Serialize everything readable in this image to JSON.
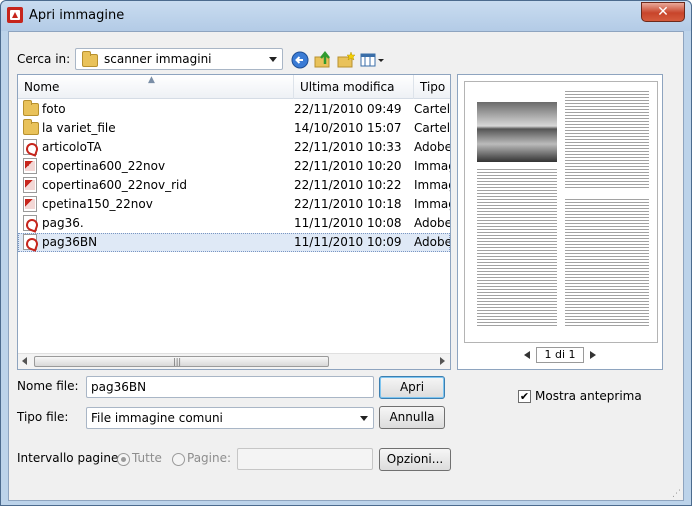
{
  "window": {
    "title": "Apri immagine",
    "close_glyph": "✕",
    "app_icon": "scanner-app-icon"
  },
  "location": {
    "label": "Cerca in:",
    "folder": "scanner immagini"
  },
  "toolbar": {
    "icons": [
      "back-icon",
      "up-folder-icon",
      "new-folder-icon",
      "view-menu-icon"
    ]
  },
  "columns": [
    "Nome",
    "Ultima modifica",
    "Tipo"
  ],
  "files": [
    {
      "name": "foto",
      "date": "22/11/2010 09:49",
      "type": "Cartella",
      "icon": "folder-icon"
    },
    {
      "name": "la variet_file",
      "date": "14/10/2010 15:07",
      "type": "Cartella",
      "icon": "folder-icon"
    },
    {
      "name": "articoloTA",
      "date": "22/11/2010 10:33",
      "type": "Adobe",
      "icon": "pdf-icon"
    },
    {
      "name": "copertina600_22nov",
      "date": "22/11/2010 10:20",
      "type": "Immagine",
      "icon": "image-icon"
    },
    {
      "name": "copertina600_22nov_rid",
      "date": "22/11/2010 10:22",
      "type": "Immagine",
      "icon": "image-icon"
    },
    {
      "name": "cpetina150_22nov",
      "date": "22/11/2010 10:18",
      "type": "Immagine",
      "icon": "image-icon"
    },
    {
      "name": "pag36.",
      "date": "11/11/2010 10:08",
      "type": "Adobe",
      "icon": "pdf-icon"
    },
    {
      "name": "pag36BN",
      "date": "11/11/2010 10:09",
      "type": "Adobe",
      "icon": "pdf-icon",
      "selected": true
    }
  ],
  "preview": {
    "page_indicator": "1 di 1",
    "show_preview_label": "Mostra anteprima",
    "show_preview_checked": true
  },
  "filename": {
    "label": "Nome file:",
    "value": "pag36BN"
  },
  "filetype": {
    "label": "Tipo file:",
    "value": "File immagine comuni"
  },
  "page_range": {
    "label": "Intervallo pagine:",
    "all_label": "Tutte",
    "pages_label": "Pagine:"
  },
  "buttons": {
    "open": "Apri",
    "cancel": "Annulla",
    "options": "Opzioni..."
  }
}
